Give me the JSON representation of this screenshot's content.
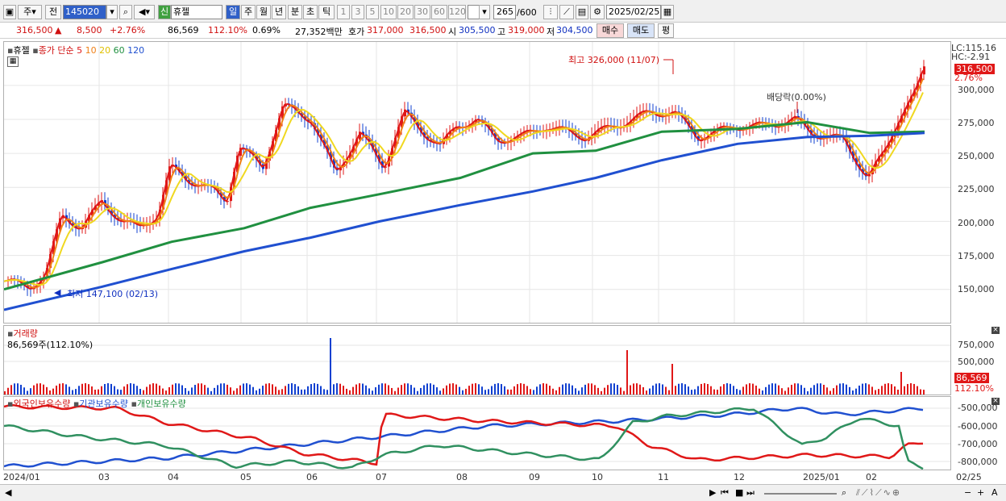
{
  "toolbar": {
    "period_label": "주",
    "prev_label": "전",
    "code_value": "145020",
    "new_badge": "신",
    "stock_name": "휴젤",
    "tf_day": "일",
    "tf_week": "주",
    "tf_month": "월",
    "tf_year": "년",
    "tf_min": "분",
    "tf_sec": "초",
    "tf_tick": "틱",
    "intervals": [
      "1",
      "3",
      "5",
      "10",
      "20",
      "30",
      "60",
      "120"
    ],
    "bar_count": "265",
    "bar_total": "/600",
    "date_value": "2025/02/25"
  },
  "info": {
    "price": "316,500",
    "arrow": "▲",
    "change": "8,500",
    "change_pct": "+2.76%",
    "volume": "86,569",
    "vol_ratio": "112.10%",
    "turnover": "0.69%",
    "amount": "27,352백만",
    "quote_label": "호가",
    "ask": "317,000",
    "bid": "316,500",
    "open_label": "시",
    "open": "305,500",
    "high_label": "고",
    "high": "319,000",
    "low_label": "저",
    "low": "304,500",
    "buy_label": "매수",
    "sell_label": "매도",
    "eval_label": "평"
  },
  "price_pane": {
    "stock_label": "휴젤",
    "ma_label": "종가 단순",
    "ma_periods": [
      "5",
      "10",
      "20",
      "60",
      "120"
    ],
    "ma_colors": [
      "#e01818",
      "#f08018",
      "#f0d820",
      "#209040",
      "#2050d0"
    ],
    "high_annot": "최고 326,000 (11/07)",
    "low_annot": "최저 147,100 (02/13)",
    "dividend_annot": "배당락(0.00%)",
    "lc": "LC:115.16",
    "hc": "HC:-2.91",
    "last_price": "316,500",
    "last_pct": "2.76%",
    "yticks": [
      "300,000",
      "275,000",
      "250,000",
      "225,000",
      "200,000",
      "175,000",
      "150,000"
    ]
  },
  "volume_pane": {
    "title": "거래량",
    "value": "86,569주(112.10%)",
    "yticks": [
      "750,000",
      "500,000",
      "250,000"
    ],
    "last_value": "86,569",
    "last_pct": "112.10%"
  },
  "holding_pane": {
    "foreign_label": "외국인보유수량",
    "inst_label": "기관보유수량",
    "indiv_label": "개인보유수량",
    "yticks": [
      "-500,000",
      "-600,000",
      "-700,000",
      "-800,000"
    ]
  },
  "xaxis": [
    "2024/01",
    "03",
    "04",
    "05",
    "06",
    "07",
    "08",
    "09",
    "10",
    "11",
    "12",
    "2025/01",
    "02",
    "02/25"
  ],
  "chart_data": {
    "type": "line",
    "title": "휴젤",
    "series": [
      {
        "name": "종가 단순 120",
        "x": [
          "2024/01",
          "03",
          "04",
          "05",
          "06",
          "07",
          "08",
          "09",
          "10",
          "11",
          "12",
          "2025/01",
          "02",
          "02/25"
        ],
        "values": [
          135000,
          152000,
          165000,
          178000,
          188000,
          200000,
          212000,
          222000,
          232000,
          245000,
          257000,
          262000,
          263000,
          265000
        ]
      },
      {
        "name": "종가 단순 60",
        "x": [
          "2024/01",
          "03",
          "04",
          "05",
          "06",
          "07",
          "08",
          "09",
          "10",
          "11",
          "12",
          "2025/01",
          "02",
          "02/25"
        ],
        "values": [
          150000,
          170000,
          185000,
          195000,
          210000,
          220000,
          232000,
          250000,
          252000,
          266000,
          268000,
          273000,
          265000,
          266000
        ]
      }
    ],
    "annotations": [
      "최고 326,000 (11/07)",
      "최저 147,100 (02/13)",
      "배당락(0.00%)"
    ],
    "ylim": [
      130000,
      335000
    ]
  }
}
